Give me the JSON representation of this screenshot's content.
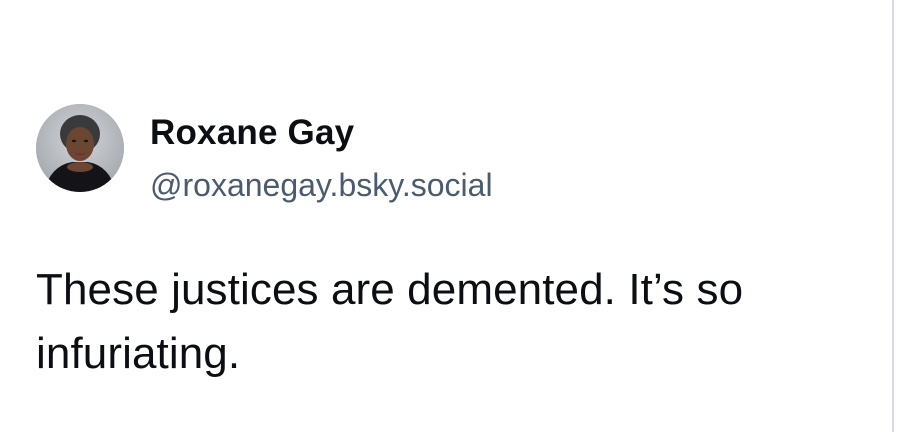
{
  "post": {
    "author": {
      "display_name": "Roxane Gay",
      "handle": "@roxanegay.bsky.social",
      "avatar_icon": "profile-photo"
    },
    "text": "These justices are demented. It’s so infuriating."
  },
  "colors": {
    "background": "#ffffff",
    "text": "#0b0f14",
    "handle": "#4b5b6f",
    "border": "#d9dde1"
  }
}
